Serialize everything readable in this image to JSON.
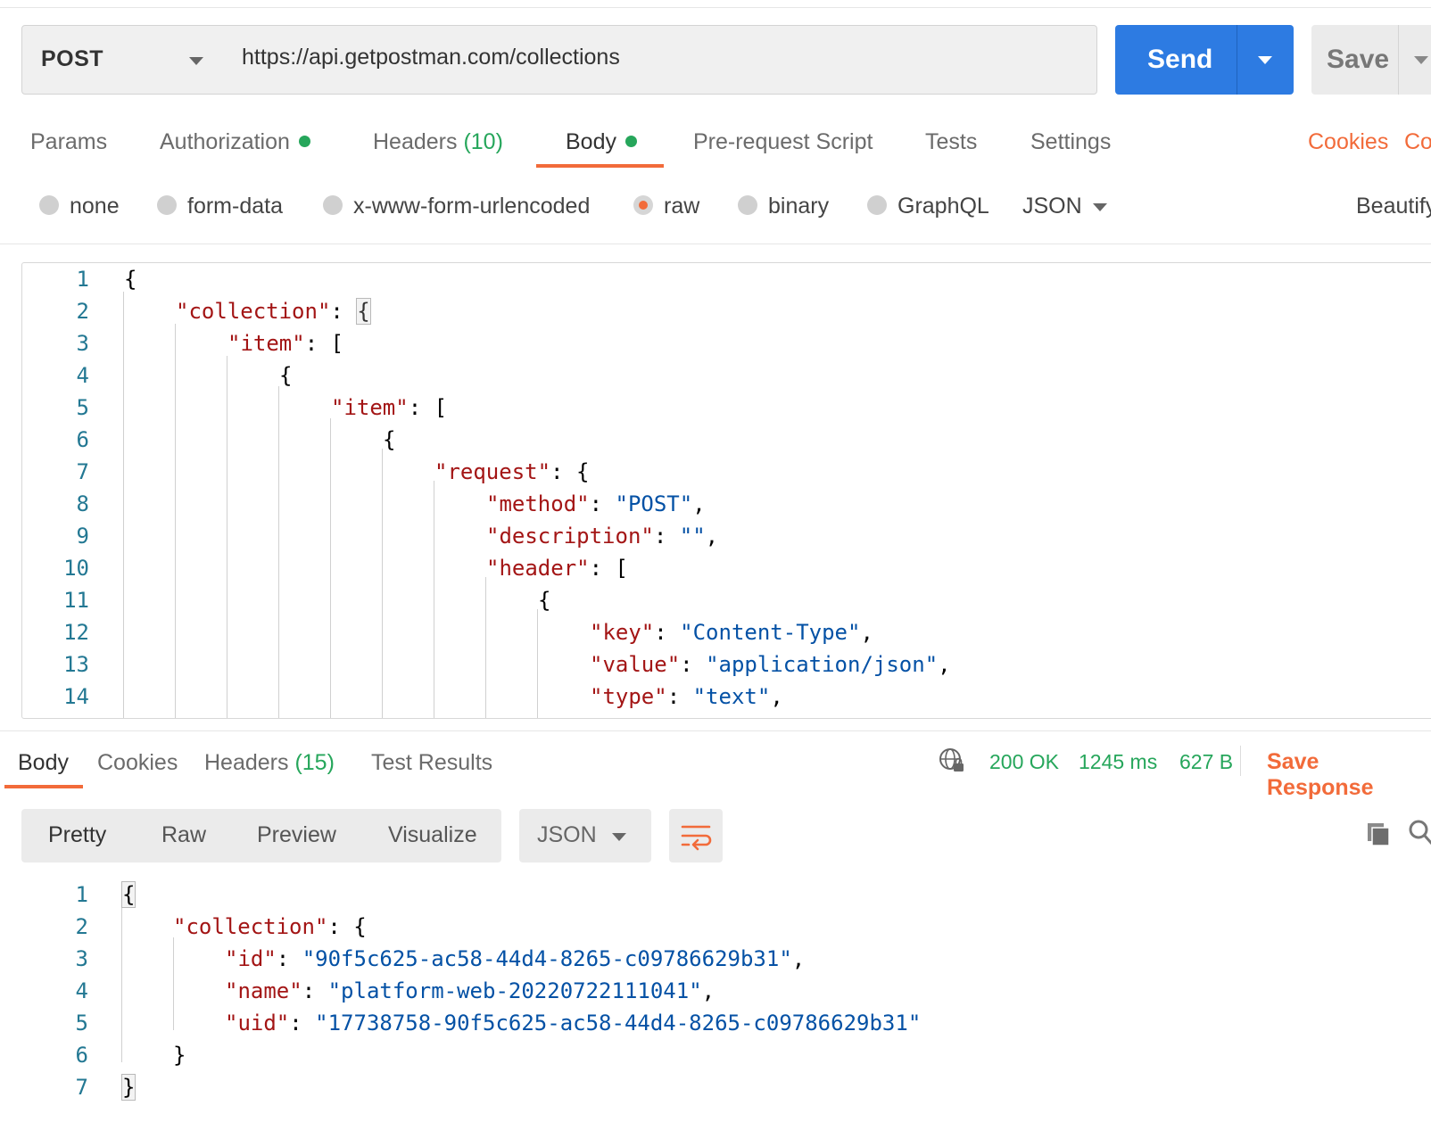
{
  "request": {
    "method": "POST",
    "url": "https://api.getpostman.com/collections",
    "send_label": "Send",
    "save_label": "Save"
  },
  "request_tabs": {
    "params": "Params",
    "authorization": "Authorization",
    "headers": "Headers",
    "headers_count": "(10)",
    "body": "Body",
    "pre_request": "Pre-request Script",
    "tests": "Tests",
    "settings": "Settings",
    "cookies": "Cookies",
    "code": "Co"
  },
  "body_types": {
    "none": "none",
    "form_data": "form-data",
    "urlencoded": "x-www-form-urlencoded",
    "raw": "raw",
    "binary": "binary",
    "graphql": "GraphQL",
    "format": "JSON",
    "beautify": "Beautify",
    "selected": "raw"
  },
  "request_body": {
    "line_numbers": [
      "1",
      "2",
      "3",
      "4",
      "5",
      "6",
      "7",
      "8",
      "9",
      "10",
      "11",
      "12",
      "13",
      "14"
    ]
  },
  "response_tabs": {
    "body": "Body",
    "cookies": "Cookies",
    "headers": "Headers",
    "headers_count": "(15)",
    "test_results": "Test Results"
  },
  "response_status": {
    "code": "200 OK",
    "time": "1245 ms",
    "size": "627 B",
    "save_response": "Save Response"
  },
  "response_view": {
    "pretty": "Pretty",
    "raw": "Raw",
    "preview": "Preview",
    "visualize": "Visualize",
    "format": "JSON"
  },
  "response_body": {
    "line_numbers": [
      "1",
      "2",
      "3",
      "4",
      "5",
      "6",
      "7"
    ],
    "id": "\"90f5c625-ac58-44d4-8265-c09786629b31\"",
    "name": "\"platform-web-20220722111041\"",
    "uid": "\"17738758-90f5c625-ac58-44d4-8265-c09786629b31\""
  },
  "colors": {
    "accent": "#f26b3a",
    "send": "#2d7be2",
    "success": "#26a65b",
    "json_key": "#a31515",
    "json_string": "#0451a5"
  }
}
